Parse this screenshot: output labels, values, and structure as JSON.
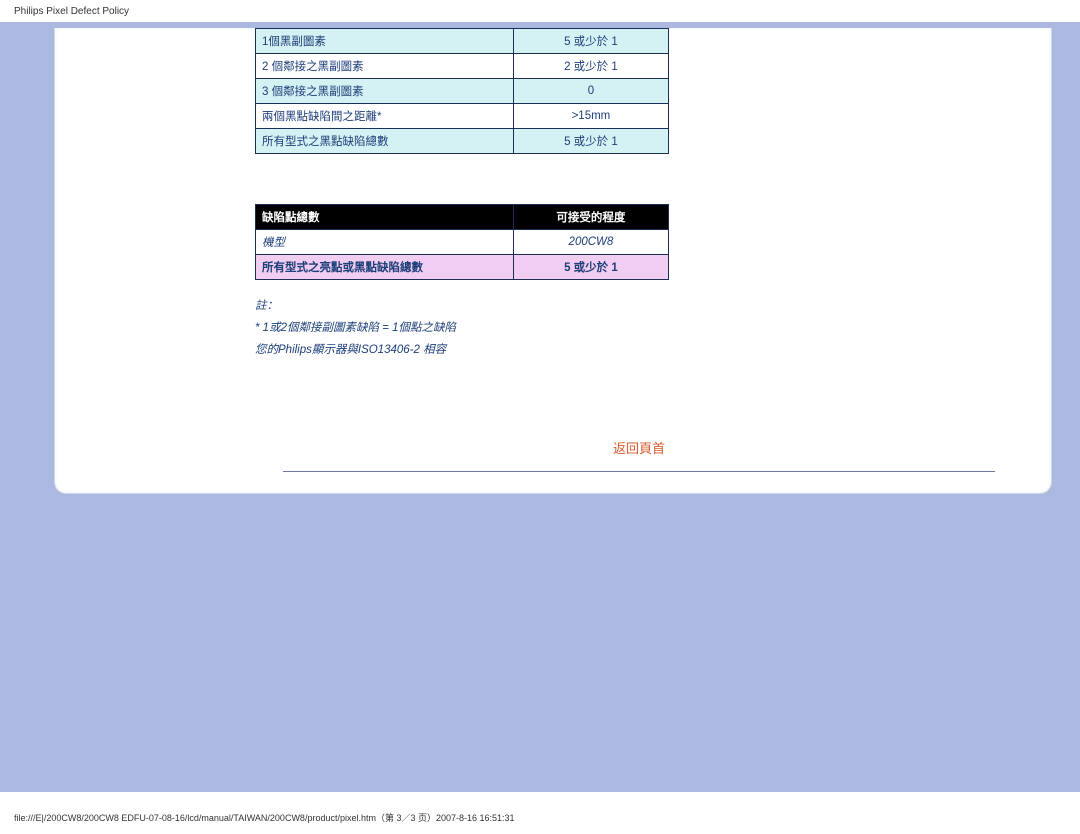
{
  "page": {
    "header_title": "Philips Pixel Defect Policy",
    "footer_path": "file:///E|/200CW8/200CW8 EDFU-07-08-16/lcd/manual/TAIWAN/200CW8/product/pixel.htm（第 3／3 页）2007-8-16 16:51:31"
  },
  "table_black": {
    "rows": [
      {
        "label": "1個黑副圖素",
        "value": "5 或少於 1",
        "hl": true
      },
      {
        "label": "2 個鄰接之黑副圖素",
        "value": "2 或少於 1",
        "hl": false
      },
      {
        "label": "3 個鄰接之黑副圖素",
        "value": "0",
        "hl": true
      },
      {
        "label": "兩個黑點缺陷間之距離*",
        "value": ">15mm",
        "hl": false
      },
      {
        "label": "所有型式之黑點缺陷總數",
        "value": "5 或少於 1",
        "hl": true
      }
    ]
  },
  "table_total": {
    "header_left": "缺陷點總數",
    "header_right": "可接受的程度",
    "model_label": "機型",
    "model_value": "200CW8",
    "total_label": "所有型式之亮點或黑點缺陷總數",
    "total_value": "5 或少於 1"
  },
  "notes": {
    "line1": "註：",
    "line2": "* 1或2個鄰接副圖素缺陷 = 1個點之缺陷",
    "line3": "您的Philips顯示器與ISO13406-2 相容"
  },
  "back_link_label": "返回頁首"
}
